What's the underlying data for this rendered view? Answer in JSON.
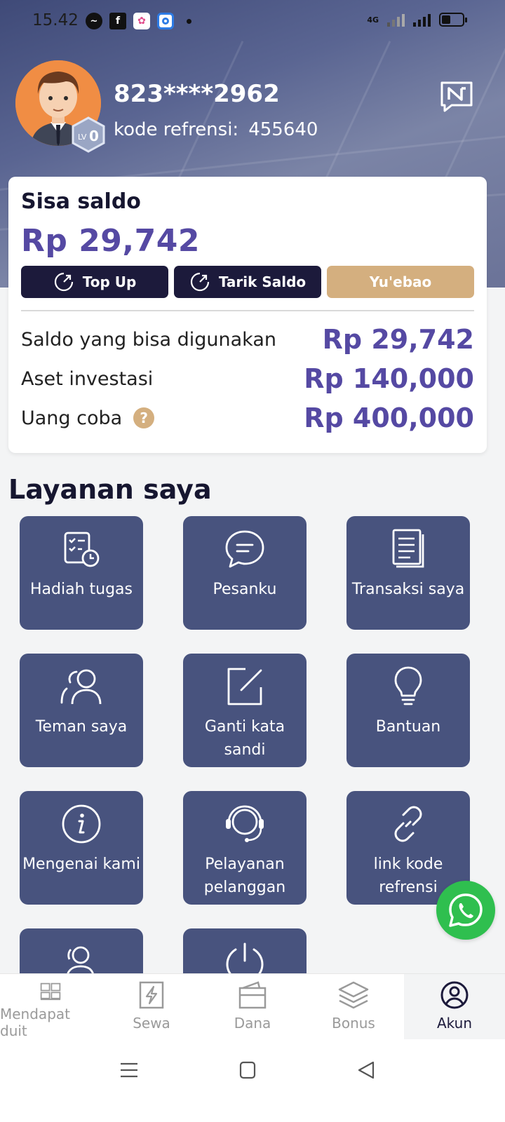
{
  "status_bar": {
    "time": "15.42",
    "network": "4G"
  },
  "profile": {
    "username": "823****2962",
    "referral_label": "kode refrensi:",
    "referral_code": "455640",
    "level": "LV0"
  },
  "balance": {
    "title": "Sisa saldo",
    "amount": "Rp 29,742",
    "buttons": {
      "top_up": "Top Up",
      "withdraw": "Tarik Saldo",
      "yuebao": "Yu'ebao"
    },
    "rows": [
      {
        "label": "Saldo yang bisa digunakan",
        "value": "Rp 29,742"
      },
      {
        "label": "Aset investasi",
        "value": "Rp 140,000"
      },
      {
        "label": "Uang coba",
        "value": "Rp 400,000"
      }
    ]
  },
  "services": {
    "title": "Layanan saya",
    "items": [
      {
        "label": "Hadiah tugas",
        "icon": "task-reward-icon"
      },
      {
        "label": "Pesanku",
        "icon": "message-icon"
      },
      {
        "label": "Transaksi saya",
        "icon": "transactions-icon"
      },
      {
        "label": "Teman saya",
        "icon": "friends-icon"
      },
      {
        "label": "Ganti kata sandi",
        "icon": "edit-password-icon"
      },
      {
        "label": "Bantuan",
        "icon": "lightbulb-icon"
      },
      {
        "label": "Mengenai kami",
        "icon": "info-icon"
      },
      {
        "label": "Pelayanan pelanggan",
        "icon": "headset-icon"
      },
      {
        "label": "link kode refrensi",
        "icon": "link-icon"
      },
      {
        "label": "",
        "icon": "user-group-icon"
      },
      {
        "label": "",
        "icon": "power-icon"
      }
    ]
  },
  "bottom_nav": {
    "items": [
      {
        "label": "Mendapat duit",
        "icon": "grid-icon"
      },
      {
        "label": "Sewa",
        "icon": "lightning-icon"
      },
      {
        "label": "Dana",
        "icon": "wallet-icon"
      },
      {
        "label": "Bonus",
        "icon": "layers-icon"
      },
      {
        "label": "Akun",
        "icon": "user-circle-icon"
      }
    ],
    "active": "Akun"
  },
  "colors": {
    "accent": "#5549a3",
    "dark_button": "#1c1a3b",
    "gold": "#d4af7f",
    "tile": "#48537e",
    "whatsapp": "#2fbf4f"
  }
}
